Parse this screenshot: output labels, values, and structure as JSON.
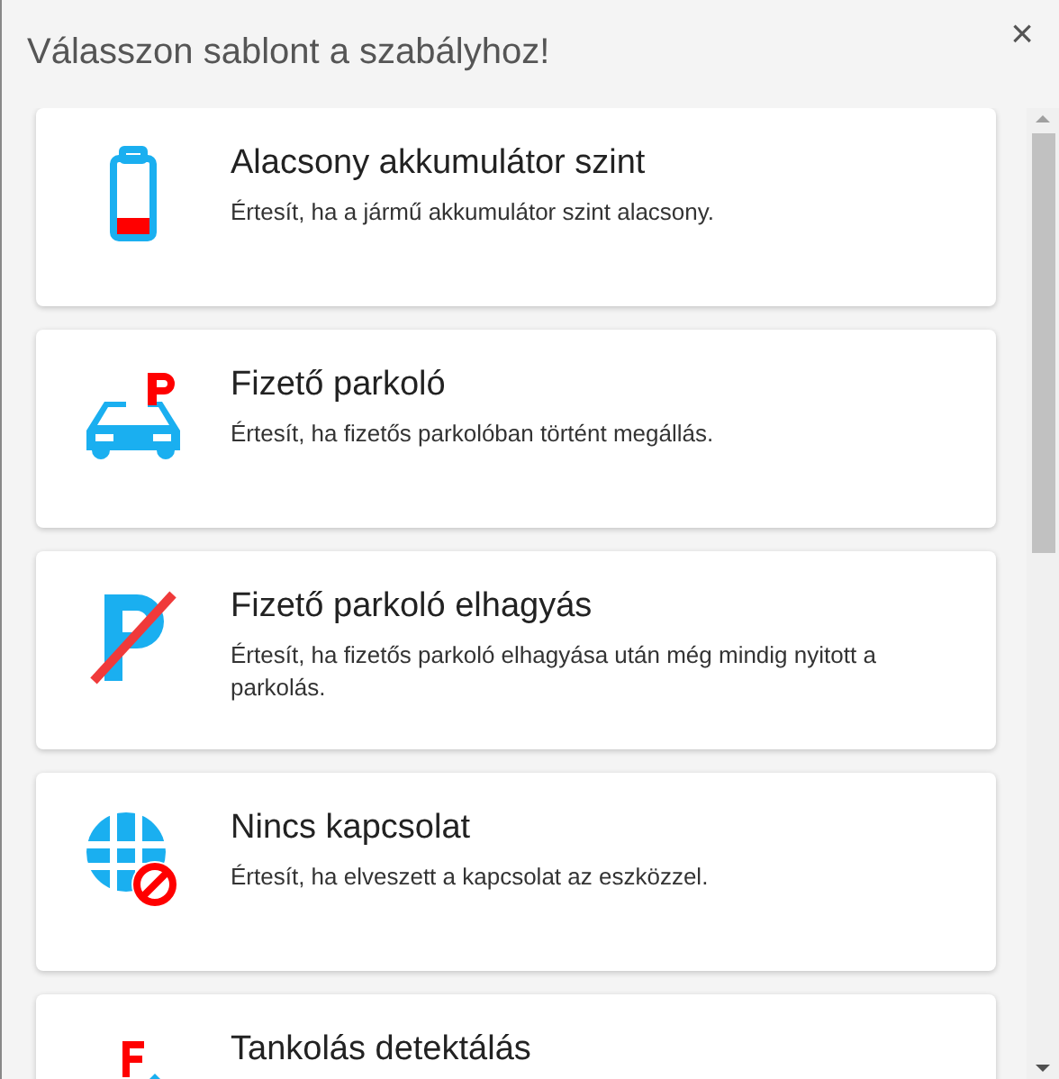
{
  "dialog": {
    "title": "Válasszon sablont a szabályhoz!",
    "close": "×"
  },
  "templates": [
    {
      "kind": "battery",
      "title": "Alacsony akkumulátor szint",
      "description": "Értesít, ha a jármű akkumulátor szint alacsony."
    },
    {
      "kind": "parking",
      "title": "Fizető parkoló",
      "description": "Értesít, ha fizetős parkolóban történt megállás."
    },
    {
      "kind": "parking-leave",
      "title": "Fizető parkoló elhagyás",
      "description": "Értesít, ha fizetős parkoló elhagyása után még mindig nyitott a parkolás."
    },
    {
      "kind": "no-connection",
      "title": "Nincs kapcsolat",
      "description": "Értesít, ha elveszett a kapcsolat az eszközzel."
    },
    {
      "kind": "refuel",
      "title": "Tankolás detektálás"
    }
  ]
}
